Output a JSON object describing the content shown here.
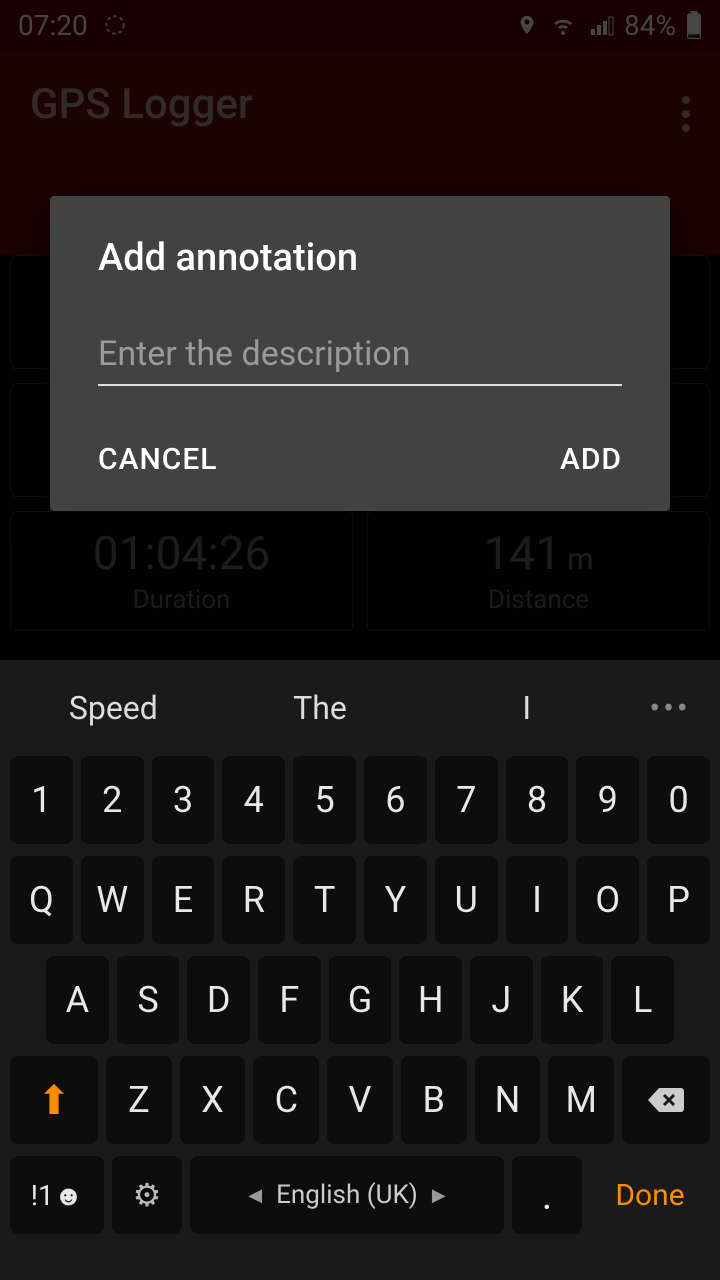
{
  "status": {
    "time": "07:20",
    "battery": "84%"
  },
  "header": {
    "title": "GPS Logger"
  },
  "stats": {
    "duration": {
      "value": "01:04:26",
      "label": "Duration"
    },
    "distance": {
      "value": "141",
      "unit": "m",
      "label": "Distance"
    }
  },
  "dialog": {
    "title": "Add annotation",
    "placeholder": "Enter the description",
    "cancel": "CANCEL",
    "add": "ADD"
  },
  "keyboard": {
    "suggestions": [
      "Speed",
      "The",
      "I"
    ],
    "row1": [
      "1",
      "2",
      "3",
      "4",
      "5",
      "6",
      "7",
      "8",
      "9",
      "0"
    ],
    "row2": [
      "Q",
      "W",
      "E",
      "R",
      "T",
      "Y",
      "U",
      "I",
      "O",
      "P"
    ],
    "row3": [
      "A",
      "S",
      "D",
      "F",
      "G",
      "H",
      "J",
      "K",
      "L"
    ],
    "row4": [
      "Z",
      "X",
      "C",
      "V",
      "B",
      "N",
      "M"
    ],
    "sym": "!1☻",
    "language": "English (UK)",
    "period": ".",
    "done": "Done"
  }
}
